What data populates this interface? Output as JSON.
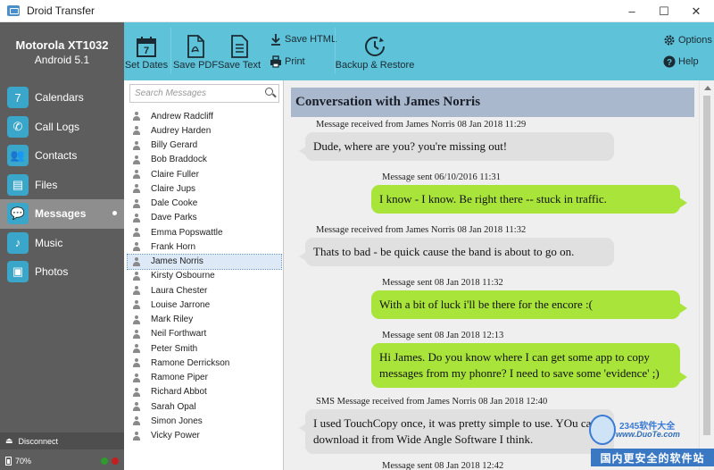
{
  "window": {
    "title": "Droid Transfer",
    "minimize": "–",
    "maximize": "☐",
    "close": "✕"
  },
  "device": {
    "name": "Motorola XT1032",
    "os": "Android 5.1"
  },
  "sidebar": {
    "items": [
      {
        "label": "Calendars",
        "icon": "7"
      },
      {
        "label": "Call Logs",
        "icon": "✆"
      },
      {
        "label": "Contacts",
        "icon": "👥"
      },
      {
        "label": "Files",
        "icon": "▤"
      },
      {
        "label": "Messages",
        "icon": "💬",
        "active": true
      },
      {
        "label": "Music",
        "icon": "♪"
      },
      {
        "label": "Photos",
        "icon": "▣"
      }
    ],
    "disconnect_label": "Disconnect",
    "battery_label": "70%",
    "battery_level": 0.7,
    "status_colors": [
      "#2e9c2e",
      "#c41f1f"
    ]
  },
  "toolbar": {
    "set_dates": "Set Dates",
    "save_pdf": "Save PDF",
    "save_text": "Save Text",
    "save_html": "Save HTML",
    "print": "Print",
    "backup_restore": "Backup & Restore",
    "options": "Options",
    "help": "Help",
    "calendar_day": "7"
  },
  "search": {
    "placeholder": "Search Messages"
  },
  "contacts": [
    "Andrew Radcliff",
    "Audrey Harden",
    "Billy Gerard",
    "Bob Braddock",
    "Claire Fuller",
    "Claire Jups",
    "Dale Cooke",
    "Dave Parks",
    "Emma Popswattle",
    "Frank Horn",
    "James Norris",
    "Kirsty Osbourne",
    "Laura Chester",
    "Louise Jarrone",
    "Mark Riley",
    "Neil Forthwart",
    "Peter Smith",
    "Ramone Derrickson",
    "Ramone Piper",
    "Richard Abbot",
    "Sarah Opal",
    "Simon Jones",
    "Vicky Power"
  ],
  "selected_contact": "James Norris",
  "conversation": {
    "title": "Conversation with James Norris",
    "messages": [
      {
        "meta": "Message received from James Norris 08 Jan 2018 11:29",
        "text": "Dude, where are you? you're missing out!",
        "dir": "recv"
      },
      {
        "meta": "Message sent 06/10/2016 11:31",
        "text": "I know - I know. Be right there -- stuck in traffic.",
        "dir": "sent"
      },
      {
        "meta": "Message received from James Norris 08 Jan 2018 11:32",
        "text": "Thats to bad - be quick cause the band is about to go on.",
        "dir": "recv"
      },
      {
        "meta": "Message sent 08 Jan 2018 11:32",
        "text": "With a bit of luck i'll be there for the encore :(",
        "dir": "sent"
      },
      {
        "meta": "Message sent 08 Jan 2018 12:13",
        "text": "Hi James. Do you know where I can get some app to copy messages from my phonre? I need to save some 'evidence' ;)",
        "dir": "sent"
      },
      {
        "meta": "SMS Message received from James Norris 08 Jan 2018 12:40",
        "text": "I used TouchCopy once, it was pretty simple to use. YOu can download it from Wide Angle Software I think.",
        "dir": "recv"
      },
      {
        "meta": "Message sent 08 Jan 2018 12:42",
        "text": "",
        "dir": "sent"
      }
    ]
  },
  "watermark": {
    "logo": "2345软件大全",
    "site": "www.DuoTe.com",
    "bar": "国内更安全的软件站"
  }
}
